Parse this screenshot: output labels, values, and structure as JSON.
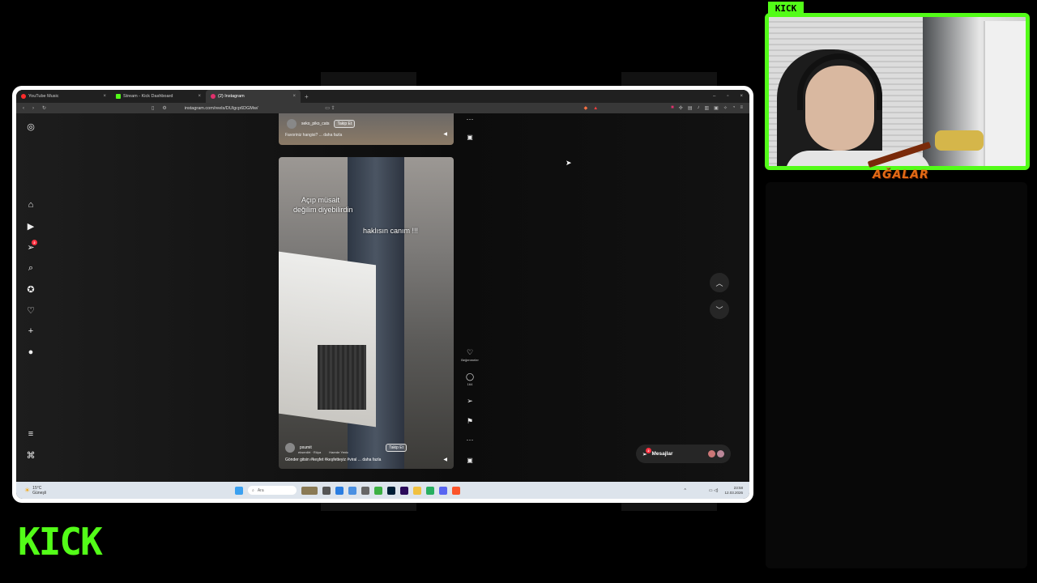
{
  "browser": {
    "tabs": [
      {
        "label": "YouTube Music",
        "favicon_color": "#ff2b2b",
        "active": false
      },
      {
        "label": "Stream - Kick Dashboard",
        "favicon_color": "#53fc18",
        "active": false
      },
      {
        "label": "(2) Instagram",
        "favicon_color": "#e1306c",
        "active": true
      }
    ],
    "new_tab": "+",
    "url": "instagram.com/reels/DUIgcp6DGMw/"
  },
  "instagram": {
    "nav_icons": [
      "instagram-icon",
      "home-icon",
      "reels-icon",
      "messages-icon",
      "search-icon",
      "explore-icon",
      "heart-icon",
      "create-icon",
      "profile-icon",
      "menu-icon",
      "meta-icon"
    ],
    "notification_count": "2",
    "prev_reel": {
      "username": "seko_piko_cats",
      "follow_label": "Takip Et",
      "caption": "Favoriniz hangisi? ... daha fazla"
    },
    "reel": {
      "overlay_line1": "Açıp müsait",
      "overlay_line2": "değilim diyebilirdin",
      "overlay_line3": "haklısın canım !!!",
      "username": "pxumit",
      "audio": "ekserdirt · Rüya",
      "collab": "Haerde Yenic",
      "follow_label": "Takip Et",
      "caption": "Gönder gitsin #keşfet #keşfetteyiz #viral ... daha fazla"
    },
    "actions": {
      "likes_label": "Beğenmeler",
      "comments_count": "164"
    },
    "messages_label": "Mesajlar",
    "messages_badge": "2"
  },
  "taskbar": {
    "weather_temp": "15°C",
    "weather_desc": "Güneşli",
    "search_placeholder": "Ara",
    "time": "23:58",
    "date": "12.03.2026"
  },
  "stream": {
    "cam_label": "KICK",
    "overlay_brand": "AĞALAR",
    "logo": "KICK",
    "accent_color": "#53fc18"
  }
}
